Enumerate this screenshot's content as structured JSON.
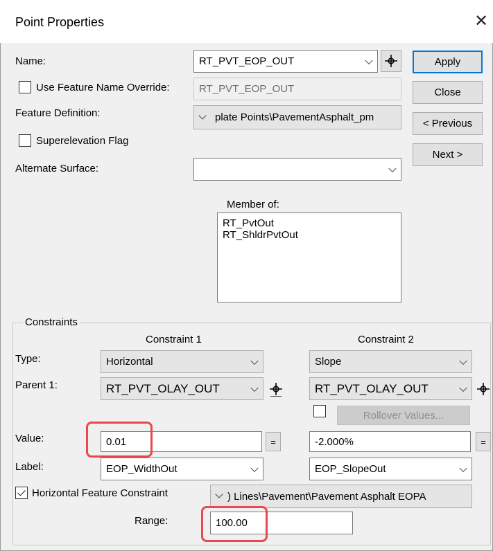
{
  "dialog": {
    "title": "Point Properties",
    "close_glyph": "✕"
  },
  "name": {
    "label": "Name:",
    "value": "RT_PVT_EOP_OUT"
  },
  "override": {
    "label": "Use Feature Name Override:",
    "value": "RT_PVT_EOP_OUT",
    "checked": false
  },
  "feature_definition": {
    "label": "Feature Definition:",
    "value": "plate Points\\PavementAsphalt_pm"
  },
  "superelevation": {
    "label": "Superelevation Flag",
    "checked": false
  },
  "alternate_surface": {
    "label": "Alternate Surface:",
    "value": ""
  },
  "buttons": {
    "apply": "Apply",
    "close": "Close",
    "previous": "< Previous",
    "next": "Next >"
  },
  "member_of": {
    "label": "Member of:",
    "items": [
      "RT_PvtOut",
      "RT_ShldrPvtOut"
    ]
  },
  "constraints": {
    "group_label": "Constraints",
    "row_labels": {
      "type": "Type:",
      "parent1": "Parent 1:",
      "value": "Value:",
      "label": "Label:",
      "range": "Range:"
    },
    "c1": {
      "header": "Constraint 1",
      "type": "Horizontal",
      "parent1": "RT_PVT_OLAY_OUT",
      "value": "0.01",
      "label": "EOP_WidthOut"
    },
    "c2": {
      "header": "Constraint 2",
      "type": "Slope",
      "parent1": "RT_PVT_OLAY_OUT",
      "value": "-2.000%",
      "label": "EOP_SlopeOut",
      "rollover_label": "Rollover Values...",
      "rollover_checked": false
    },
    "eq_glyph": "=",
    "horizontal_feature": {
      "label": "Horizontal Feature Constraint",
      "checked": true,
      "value": ") Lines\\Pavement\\Pavement Asphalt EOPA"
    },
    "range_value": "100.00"
  },
  "colors": {
    "highlight": "#e8484f",
    "default_button_border": "#0078d7"
  }
}
